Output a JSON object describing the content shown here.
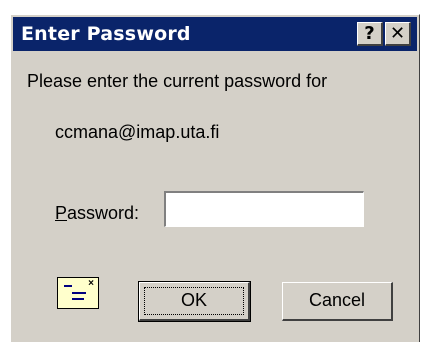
{
  "window": {
    "title": "Enter Password",
    "help_button": "?",
    "close_button": "✕"
  },
  "prompt": "Please enter the current password for",
  "account": "ccmana@imap.uta.fi",
  "password_field": {
    "label_accel": "P",
    "label_rest": "assword:",
    "value": ""
  },
  "icon": "certificate-icon",
  "buttons": {
    "ok": "OK",
    "cancel": "Cancel"
  }
}
